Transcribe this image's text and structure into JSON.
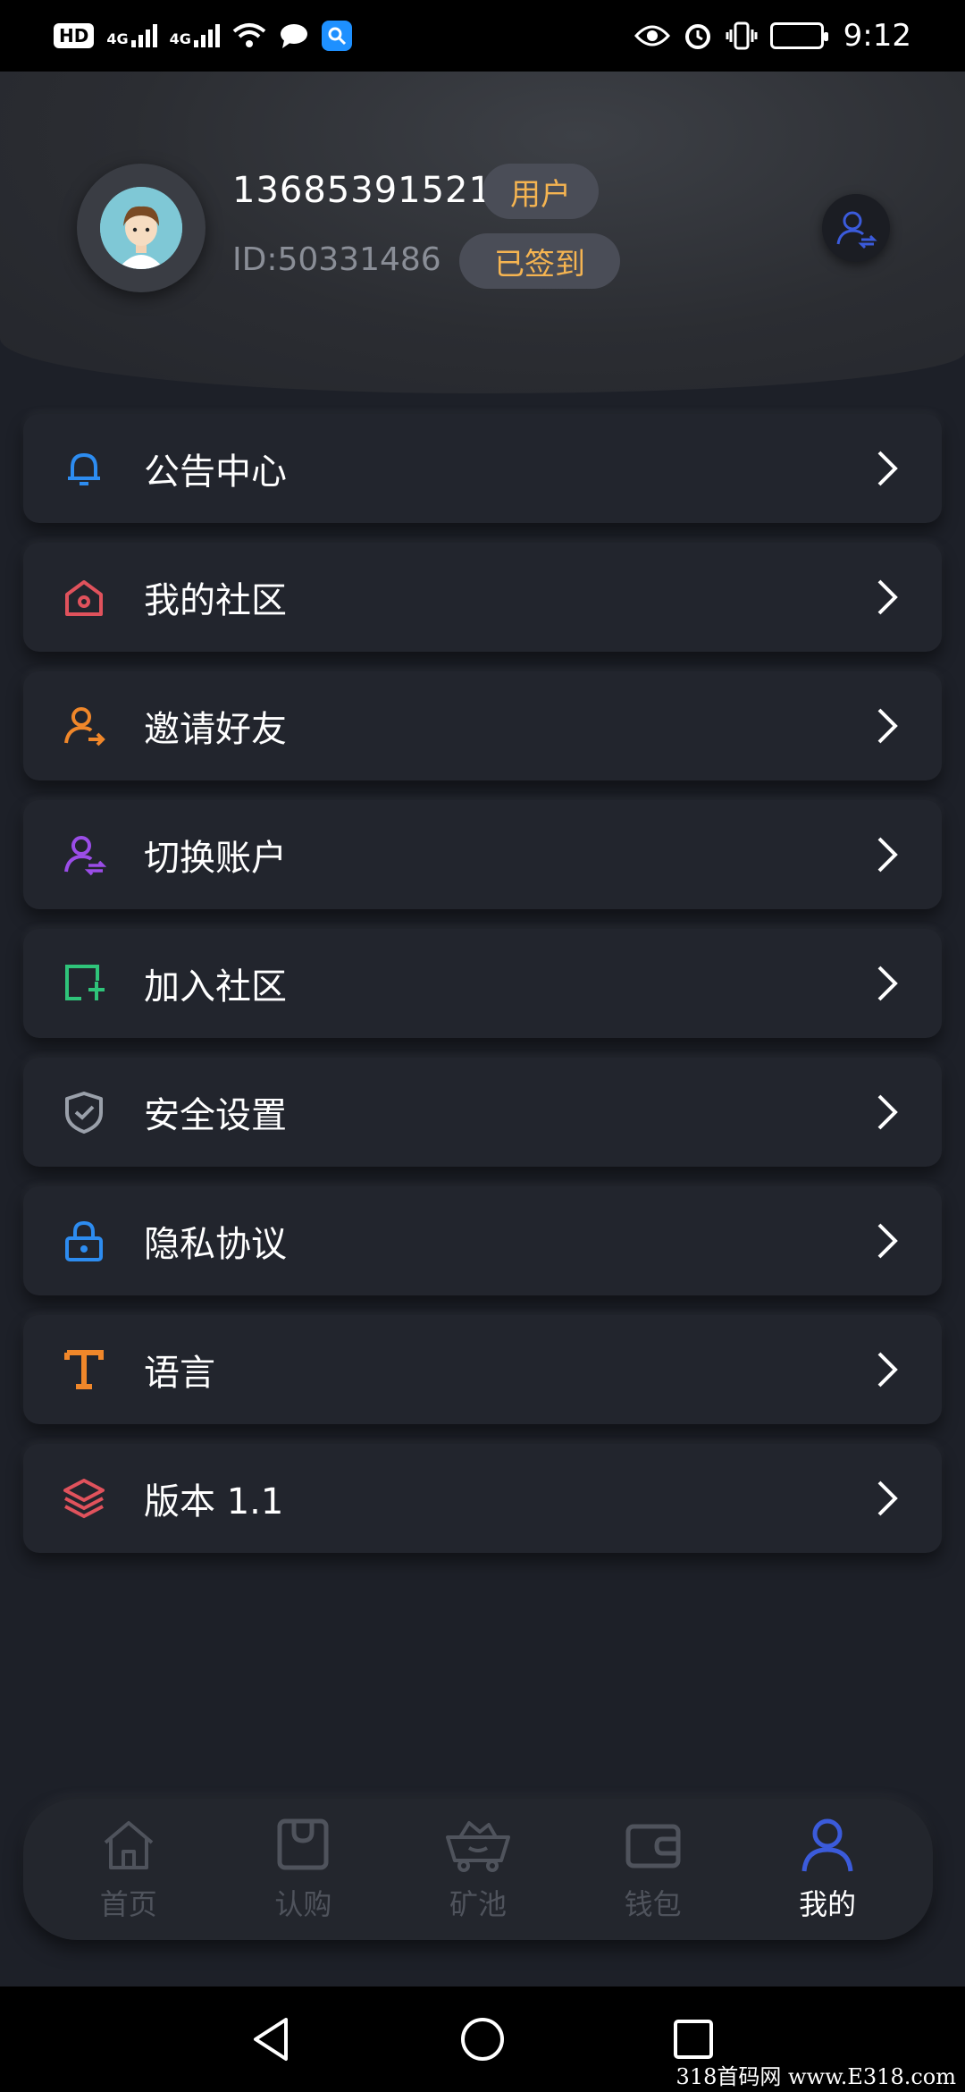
{
  "status_bar": {
    "hd": "HD",
    "sim1": "4G",
    "sim2": "4G",
    "time": "9:12"
  },
  "profile": {
    "phone": "13685391521",
    "role": "用户",
    "user_id": "ID:50331486",
    "sign_status": "已签到"
  },
  "menu": {
    "items": [
      {
        "label": "公告中心",
        "icon": "bell-icon",
        "color": "#2d8cf0"
      },
      {
        "label": "我的社区",
        "icon": "home-icon",
        "color": "#e0525c"
      },
      {
        "label": "邀请好友",
        "icon": "invite-user-icon",
        "color": "#f0872a"
      },
      {
        "label": "切换账户",
        "icon": "switch-user-icon",
        "color": "#9b4de8"
      },
      {
        "label": "加入社区",
        "icon": "add-square-icon",
        "color": "#2fc47a"
      },
      {
        "label": "安全设置",
        "icon": "shield-icon",
        "color": "#9aa0aa"
      },
      {
        "label": "隐私协议",
        "icon": "lock-icon",
        "color": "#2d8cf0"
      },
      {
        "label": "语言",
        "icon": "text-t-icon",
        "color": "#f0872a"
      },
      {
        "label": "版本 1.1",
        "icon": "layers-icon",
        "color": "#e0525c"
      }
    ]
  },
  "tabbar": {
    "tabs": [
      {
        "label": "首页",
        "icon": "house-icon"
      },
      {
        "label": "认购",
        "icon": "shopping-bag-icon"
      },
      {
        "label": "矿池",
        "icon": "mine-cart-icon"
      },
      {
        "label": "钱包",
        "icon": "wallet-icon"
      },
      {
        "label": "我的",
        "icon": "user-icon"
      }
    ],
    "active_index": 4
  },
  "watermark": "318首码网 www.E318.com",
  "colors": {
    "background": "#1d2028",
    "badge_text": "#f5b451",
    "active_tab": "#3b5bdb"
  }
}
